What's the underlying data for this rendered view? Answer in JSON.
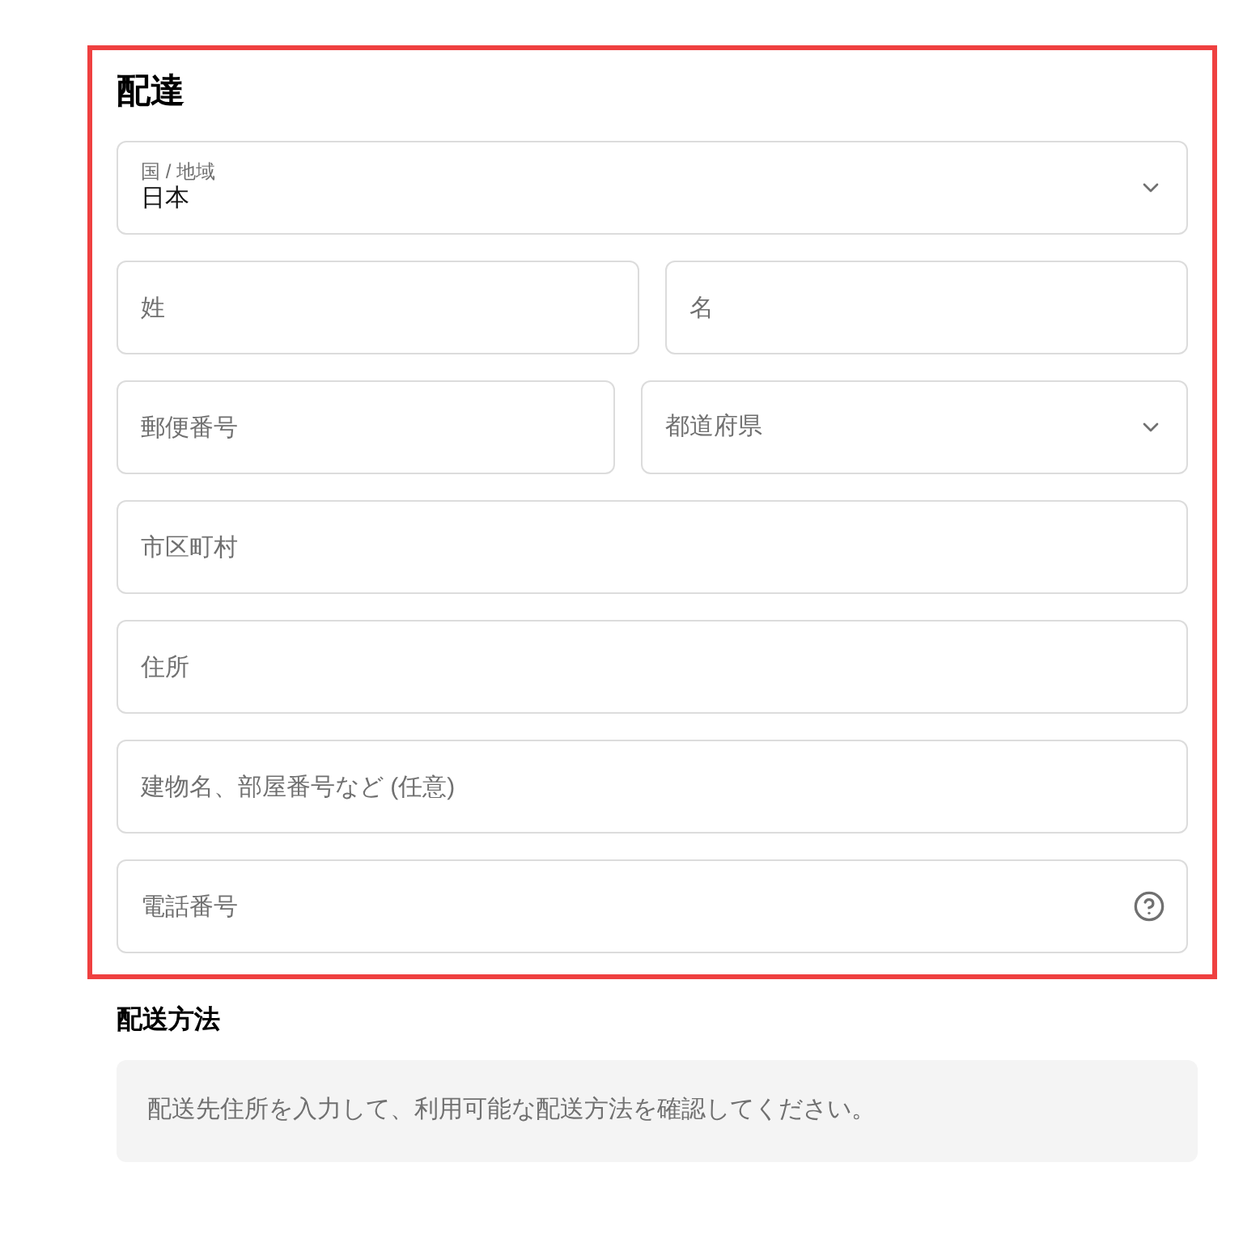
{
  "delivery": {
    "title": "配達",
    "rows": [
      [
        {
          "kind": "select",
          "label": "国 / 地域",
          "value": "日本"
        }
      ],
      [
        {
          "kind": "text",
          "placeholder": "姓"
        },
        {
          "kind": "text",
          "placeholder": "名"
        }
      ],
      [
        {
          "kind": "text",
          "placeholder": "郵便番号"
        },
        {
          "kind": "select",
          "placeholder": "都道府県"
        }
      ],
      [
        {
          "kind": "text",
          "placeholder": "市区町村"
        }
      ],
      [
        {
          "kind": "text",
          "placeholder": "住所"
        }
      ],
      [
        {
          "kind": "text",
          "placeholder": "建物名、部屋番号など (任意)"
        }
      ],
      [
        {
          "kind": "help",
          "placeholder": "電話番号"
        }
      ]
    ]
  },
  "shipping": {
    "title": "配送方法",
    "notice": "配送先住所を入力して、利用可能な配送方法を確認してください。"
  }
}
